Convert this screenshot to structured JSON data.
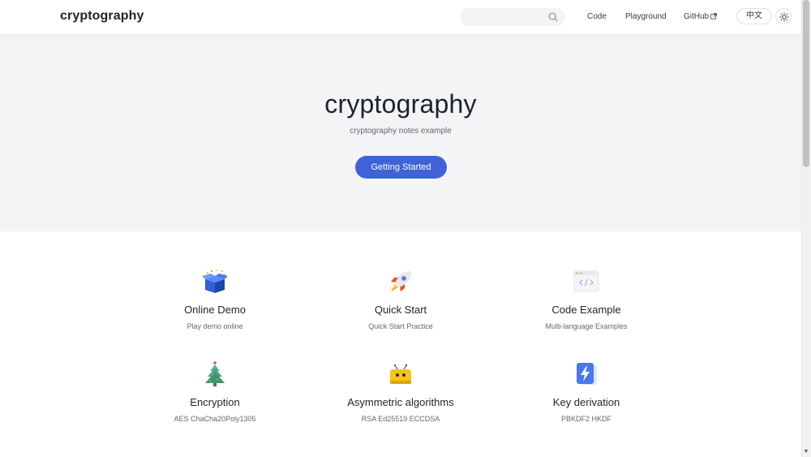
{
  "nav": {
    "title": "cryptography",
    "search_placeholder": "",
    "links": [
      {
        "label": "Code"
      },
      {
        "label": "Playground"
      },
      {
        "label": "GitHub"
      }
    ],
    "lang_label": "中文"
  },
  "hero": {
    "title": "cryptography",
    "tagline": "cryptography notes example",
    "action_label": "Getting Started"
  },
  "features": [
    {
      "icon": "gift-box-icon",
      "title": "Online Demo",
      "details": "Play demo online"
    },
    {
      "icon": "rocket-icon",
      "title": "Quick Start",
      "details": "Quick Start Practice"
    },
    {
      "icon": "code-window-icon",
      "title": "Code Example",
      "details": "Multi-language Examples"
    },
    {
      "icon": "christmas-tree-icon",
      "title": "Encryption",
      "details": "AES ChaCha20Poly1305"
    },
    {
      "icon": "robot-icon",
      "title": "Asymmetric algorithms",
      "details": "RSA Ed25519 ECCDSA"
    },
    {
      "icon": "lightning-icon",
      "title": "Key derivation",
      "details": "PBKDF2 HKDF"
    }
  ],
  "colors": {
    "brand": "#3f63d6",
    "hero_background": "#f3f4f6",
    "text": "#1f2328",
    "muted_text": "#67676c"
  }
}
